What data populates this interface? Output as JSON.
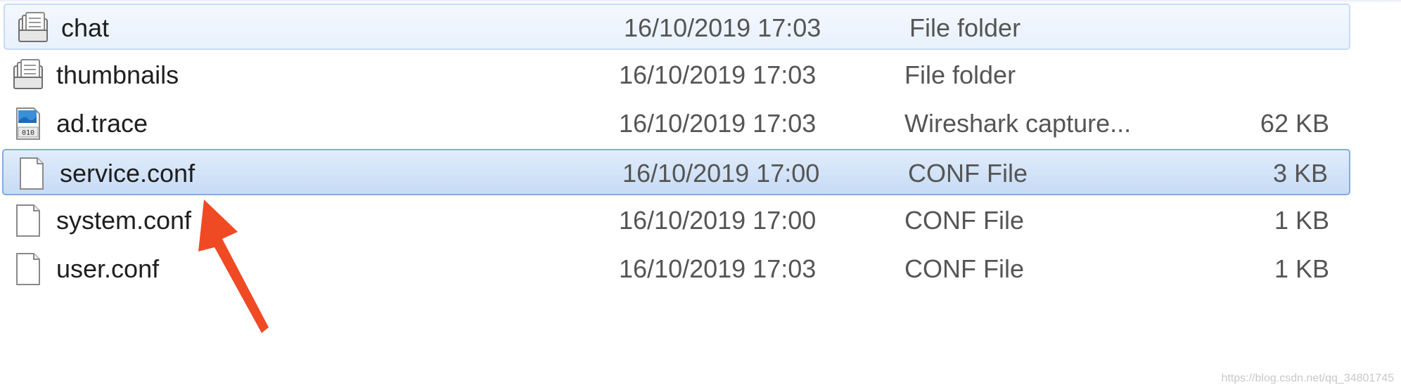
{
  "files": [
    {
      "name": "chat",
      "date": "16/10/2019 17:03",
      "type": "File folder",
      "size": "",
      "icon": "folder-icon",
      "state": "hover"
    },
    {
      "name": "thumbnails",
      "date": "16/10/2019 17:03",
      "type": "File folder",
      "size": "",
      "icon": "folder-icon",
      "state": "normal"
    },
    {
      "name": "ad.trace",
      "date": "16/10/2019 17:03",
      "type": "Wireshark capture...",
      "size": "62 KB",
      "icon": "wireshark-capture-icon",
      "state": "normal"
    },
    {
      "name": "service.conf",
      "date": "16/10/2019 17:00",
      "type": "CONF File",
      "size": "3 KB",
      "icon": "document-icon",
      "state": "selected"
    },
    {
      "name": "system.conf",
      "date": "16/10/2019 17:00",
      "type": "CONF File",
      "size": "1 KB",
      "icon": "document-icon",
      "state": "normal"
    },
    {
      "name": "user.conf",
      "date": "16/10/2019 17:03",
      "type": "CONF File",
      "size": "1 KB",
      "icon": "document-icon",
      "state": "normal"
    }
  ],
  "annotation": {
    "icon": "red-arrow-icon",
    "color": "#f04a24"
  },
  "watermark": "https://blog.csdn.net/qq_34801745",
  "colors": {
    "selection_border": "#84acdd",
    "hover_border": "#c7dcf5"
  }
}
